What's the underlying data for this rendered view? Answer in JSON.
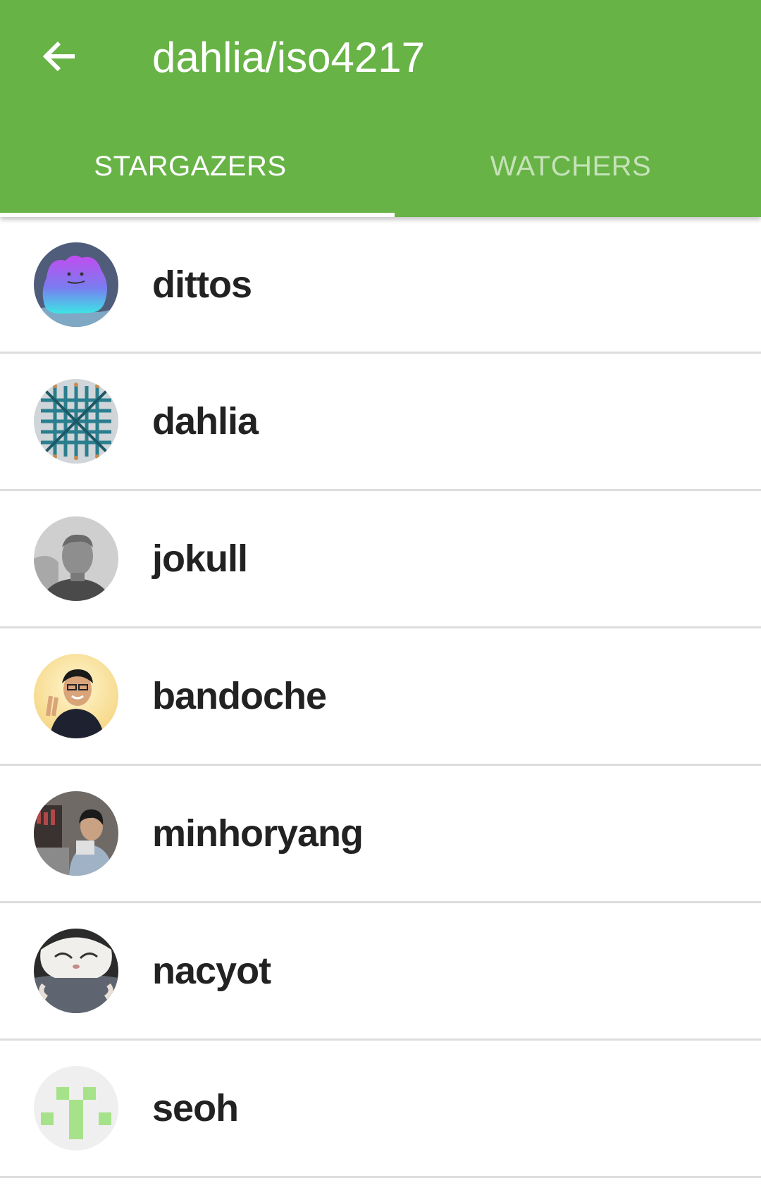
{
  "header": {
    "title": "dahlia/iso4217",
    "back_icon": "arrow-left-icon",
    "background_color": "#67b346"
  },
  "tabs": [
    {
      "label": "STARGAZERS",
      "active": true
    },
    {
      "label": "WATCHERS",
      "active": false
    }
  ],
  "users": [
    {
      "name": "dittos",
      "avatar": "ditto-avatar"
    },
    {
      "name": "dahlia",
      "avatar": "pattern-avatar"
    },
    {
      "name": "jokull",
      "avatar": "portrait-photo-avatar"
    },
    {
      "name": "bandoche",
      "avatar": "portrait-photo-avatar"
    },
    {
      "name": "minhoryang",
      "avatar": "photo-avatar"
    },
    {
      "name": "nacyot",
      "avatar": "cat-photo-avatar"
    },
    {
      "name": "seoh",
      "avatar": "identicon-avatar"
    }
  ]
}
